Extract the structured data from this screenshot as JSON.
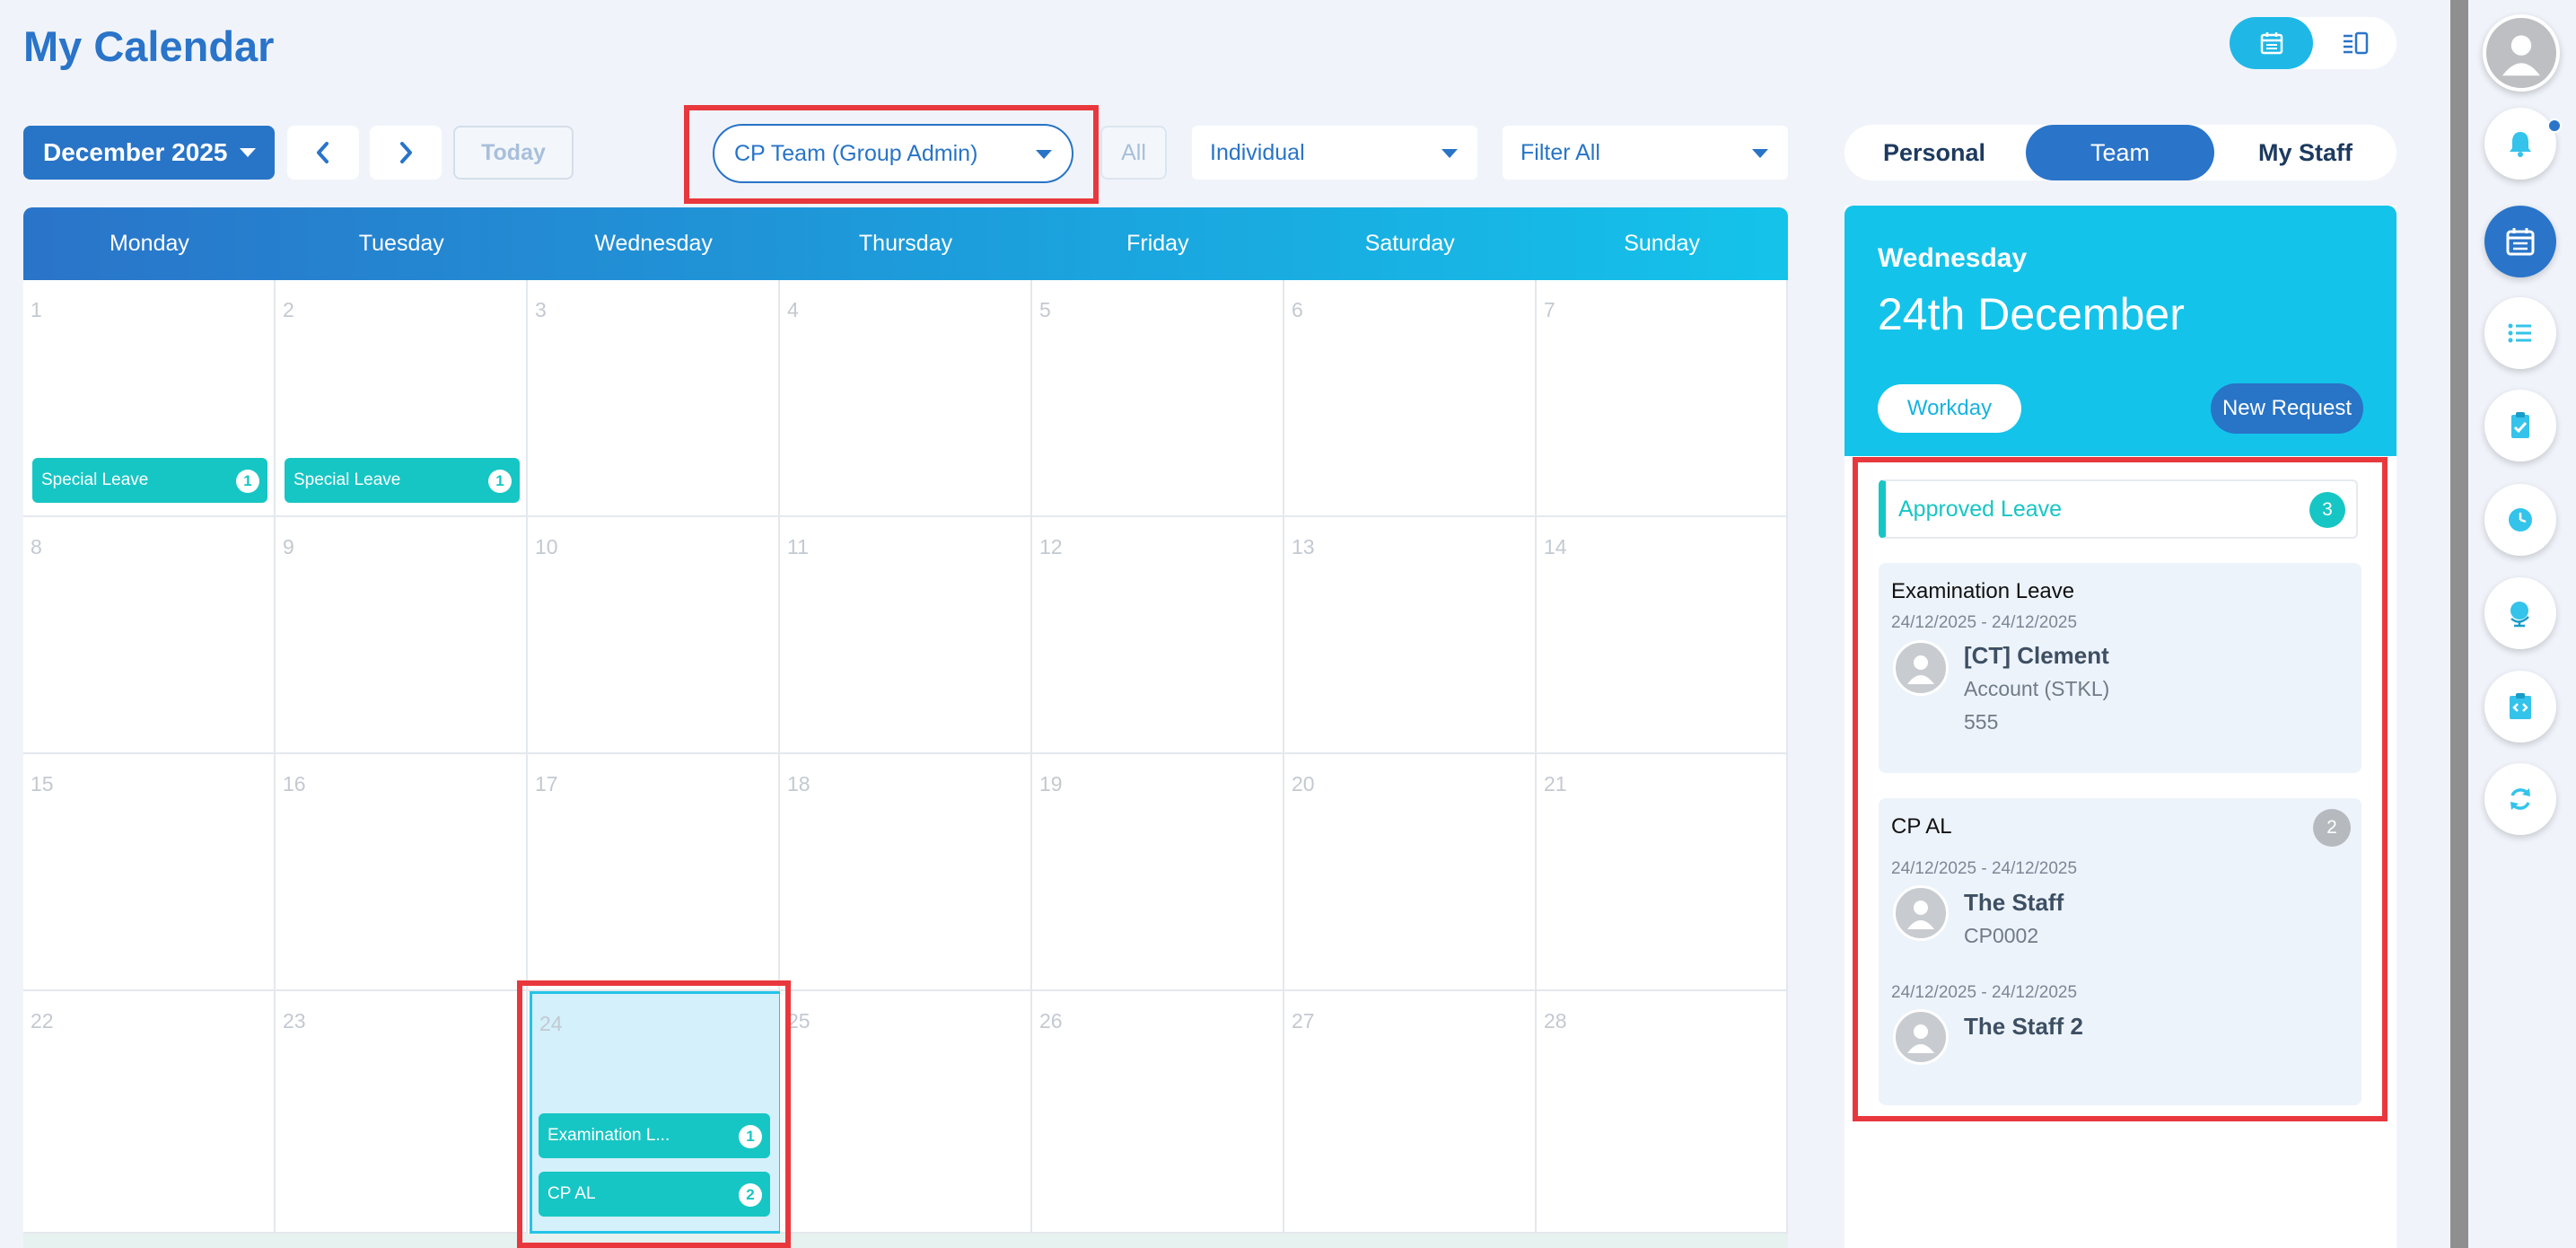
{
  "header": {
    "title": "My Calendar"
  },
  "toolbar": {
    "month_label": "December 2025",
    "today_label": "Today",
    "team_select": "CP Team (Group Admin)",
    "all_label": "All",
    "type_select": "Individual",
    "filter_select": "Filter All"
  },
  "segments": {
    "personal": "Personal",
    "team": "Team",
    "my_staff": "My Staff",
    "selected": "Team"
  },
  "calendar": {
    "weekdays": [
      "Monday",
      "Tuesday",
      "Wednesday",
      "Thursday",
      "Friday",
      "Saturday",
      "Sunday"
    ],
    "days": [
      "1",
      "2",
      "3",
      "4",
      "5",
      "6",
      "7",
      "8",
      "9",
      "10",
      "11",
      "12",
      "13",
      "14",
      "15",
      "16",
      "17",
      "18",
      "19",
      "20",
      "21",
      "22",
      "23",
      "24",
      "25",
      "26",
      "27",
      "28"
    ],
    "selected_day": "24",
    "events": {
      "d1": {
        "label": "Special Leave",
        "count": "1"
      },
      "d2": {
        "label": "Special Leave",
        "count": "1"
      },
      "d24a": {
        "label": "Examination L...",
        "count": "1"
      },
      "d24b": {
        "label": "CP AL",
        "count": "2"
      }
    }
  },
  "panel": {
    "weekday": "Wednesday",
    "date": "24th December",
    "workday_label": "Workday",
    "new_request_label": "New Request",
    "approved_label": "Approved Leave",
    "approved_count": "3",
    "leaves": [
      {
        "type": "Examination Leave",
        "range": "24/12/2025 - 24/12/2025",
        "name": "[CT] Clement",
        "dept": "Account (STKL)",
        "code": "555"
      },
      {
        "type": "CP AL",
        "count": "2",
        "entries": [
          {
            "range": "24/12/2025 - 24/12/2025",
            "name": "The Staff",
            "code": "CP0002"
          },
          {
            "range": "24/12/2025 - 24/12/2025",
            "name": "The Staff 2"
          }
        ]
      }
    ]
  },
  "colors": {
    "primary": "#2a74c9",
    "accent": "#14c3ea",
    "teal": "#16c6c4",
    "highlight": "#e8383d"
  },
  "icons": [
    "calendar-view-icon",
    "list-view-icon",
    "chevron-left-icon",
    "chevron-right-icon",
    "user-avatar-icon",
    "bell-icon",
    "calendar-icon",
    "list-icon",
    "clipboard-check-icon",
    "clock-icon",
    "globe-icon",
    "code-icon",
    "refresh-icon"
  ]
}
